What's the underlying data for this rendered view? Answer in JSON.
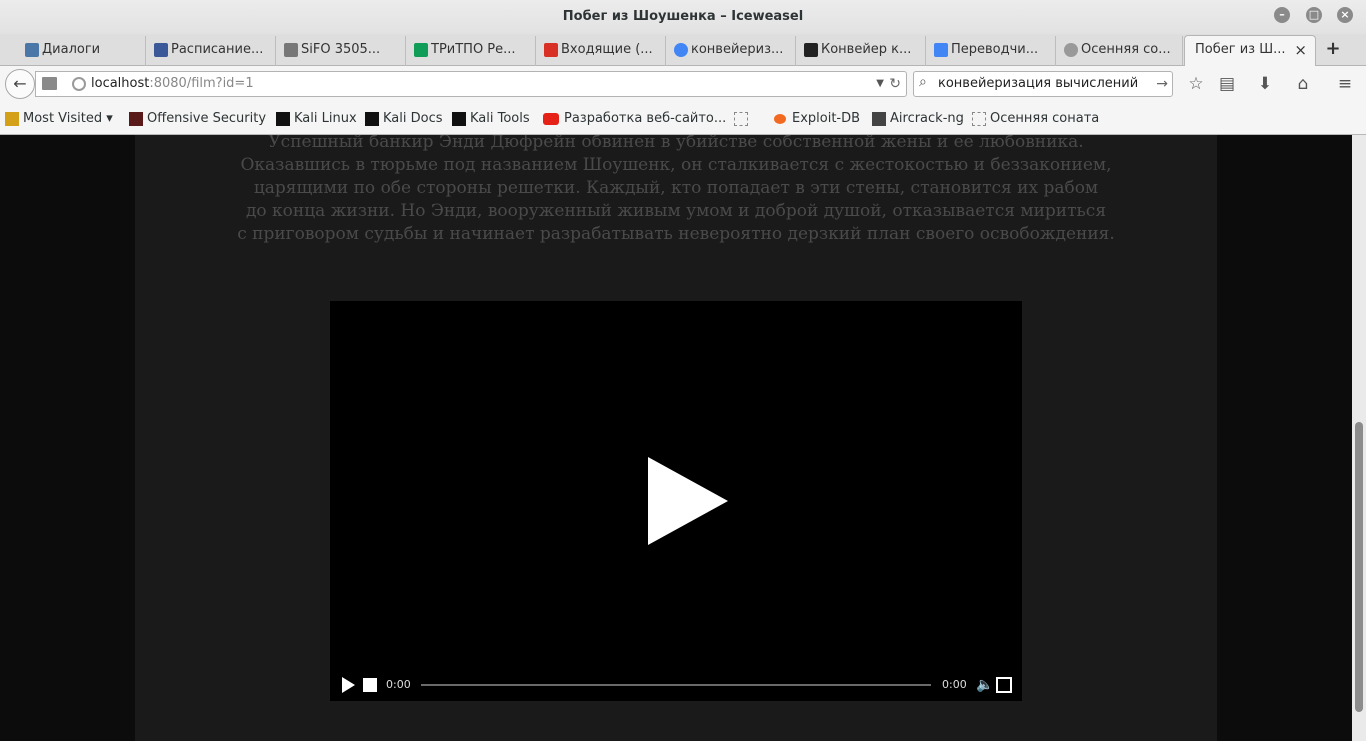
{
  "window": {
    "title": "Побег из Шоушенка – Iceweasel"
  },
  "tabs": [
    {
      "label": "Диалоги",
      "favicon": "vk-icon",
      "color": "#4a76a8"
    },
    {
      "label": "Расписание...",
      "favicon": "schedule-icon",
      "color": "#3b5998"
    },
    {
      "label": "SiFO 3505...",
      "favicon": "page-icon",
      "color": "#777777"
    },
    {
      "label": "ТРиТПО Ре...",
      "favicon": "sheets-icon",
      "color": "#0f9d58"
    },
    {
      "label": "Входящие (...",
      "favicon": "gmail-icon",
      "color": "#d93025"
    },
    {
      "label": "конвейериз...",
      "favicon": "google-icon",
      "color": "#4285f4"
    },
    {
      "label": "Конвейер к...",
      "favicon": "habr-icon",
      "color": "#222222"
    },
    {
      "label": "Переводчи...",
      "favicon": "translate-icon",
      "color": "#4285f4"
    },
    {
      "label": "Осенняя со...",
      "favicon": "film-icon",
      "color": "#999999"
    },
    {
      "label": "Побег из Ш...",
      "active": true
    }
  ],
  "navbar": {
    "url_host": "localhost",
    "url_rest": ":8080/film?id=1",
    "search_query": "конвейеризация вычислений"
  },
  "bookmarks": [
    {
      "label": "Most Visited ▾",
      "icon": "most-visited-icon",
      "color": "#d4a017"
    },
    {
      "label": "Offensive Security",
      "icon": "offsec-icon",
      "color": "#5a1a1a"
    },
    {
      "label": "Kali Linux",
      "icon": "kali-icon",
      "color": "#111111"
    },
    {
      "label": "Kali Docs",
      "icon": "kali-icon",
      "color": "#111111"
    },
    {
      "label": "Kali Tools",
      "icon": "kali-icon",
      "color": "#111111"
    },
    {
      "label": "Разработка веб-сайто...",
      "icon": "youtube-icon",
      "color": "#e62117"
    },
    {
      "label": "",
      "icon": "blank-icon",
      "color": "#888888"
    },
    {
      "label": "Exploit-DB",
      "icon": "exploitdb-icon",
      "color": "#f26a21"
    },
    {
      "label": "Aircrack-ng",
      "icon": "aircrack-icon",
      "color": "#444444"
    },
    {
      "label": "Осенняя соната",
      "icon": "blank-icon",
      "color": "#888888"
    }
  ],
  "content": {
    "description": [
      "Успешный банкир Энди Дюфрейн обвинен в убийстве собственной жены и ее любовника.",
      "Оказавшись в тюрьме под названием Шоушенк, он сталкивается с жестокостью и беззаконием,",
      "царящими по обе стороны решетки. Каждый, кто попадает в эти стены, становится их рабом",
      "до конца жизни. Но Энди, вооруженный живым умом и доброй душой, отказывается мириться",
      "с приговором судьбы и начинает разрабатывать невероятно дерзкий план своего освобождения."
    ],
    "video": {
      "current_time": "0:00",
      "duration": "0:00",
      "progress": 0
    }
  }
}
